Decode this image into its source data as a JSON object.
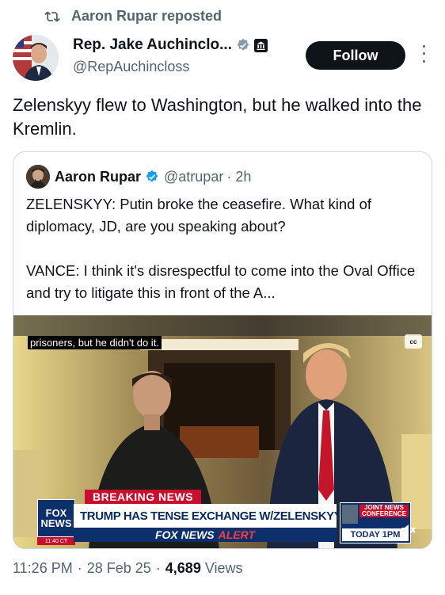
{
  "repost": {
    "icon": "repost-icon",
    "text": "Aaron Rupar reposted"
  },
  "author": {
    "name": "Rep. Jake Auchinclo...",
    "handle": "@RepAuchincloss",
    "verified_icon": "gray-verified-badge-icon",
    "affiliation_icon": "government-building-icon",
    "follow_label": "Follow",
    "more_icon": "more-options-icon"
  },
  "tweet": {
    "text": "Zelenskyy flew to Washington, but he walked into the Kremlin."
  },
  "quoted": {
    "name": "Aaron Rupar",
    "verified_icon": "blue-verified-badge-icon",
    "handle": "@atrupar",
    "time": "· 2h",
    "paragraph_1": "ZELENSKYY: Putin broke the ceasefire. What kind of diplomacy, JD, are you speaking about?",
    "paragraph_2": "VANCE: I think it's disrespectful to come into the Oval Office and try to litigate this in front of the A..."
  },
  "video": {
    "caption": "prisoners, but he didn't do it.",
    "cc_label": "cc",
    "breaking_label": "BREAKING NEWS",
    "headline": "TRUMP HAS TENSE EXCHANGE W/ZELENSKYY DURING MTG",
    "alert_prefix": "FOX NEWS",
    "alert_suffix": "ALERT",
    "logo_line1": "FOX",
    "logo_line2": "NEWS",
    "logo_time": "11:40 CT",
    "joint_label": "JOINT NEWS CONFERENCE",
    "today_label": "TODAY 1PM",
    "mute_icon": "speaker-muted-icon"
  },
  "meta": {
    "time": "11:26 PM",
    "date": "28 Feb 25",
    "views_count": "4,689",
    "views_label": "Views"
  },
  "colors": {
    "text_primary": "#0f1419",
    "text_secondary": "#536471",
    "border": "#cfd9de",
    "fox_red": "#c8102e",
    "fox_blue": "#0d2f6b",
    "verified_blue": "#1d9bf0"
  }
}
